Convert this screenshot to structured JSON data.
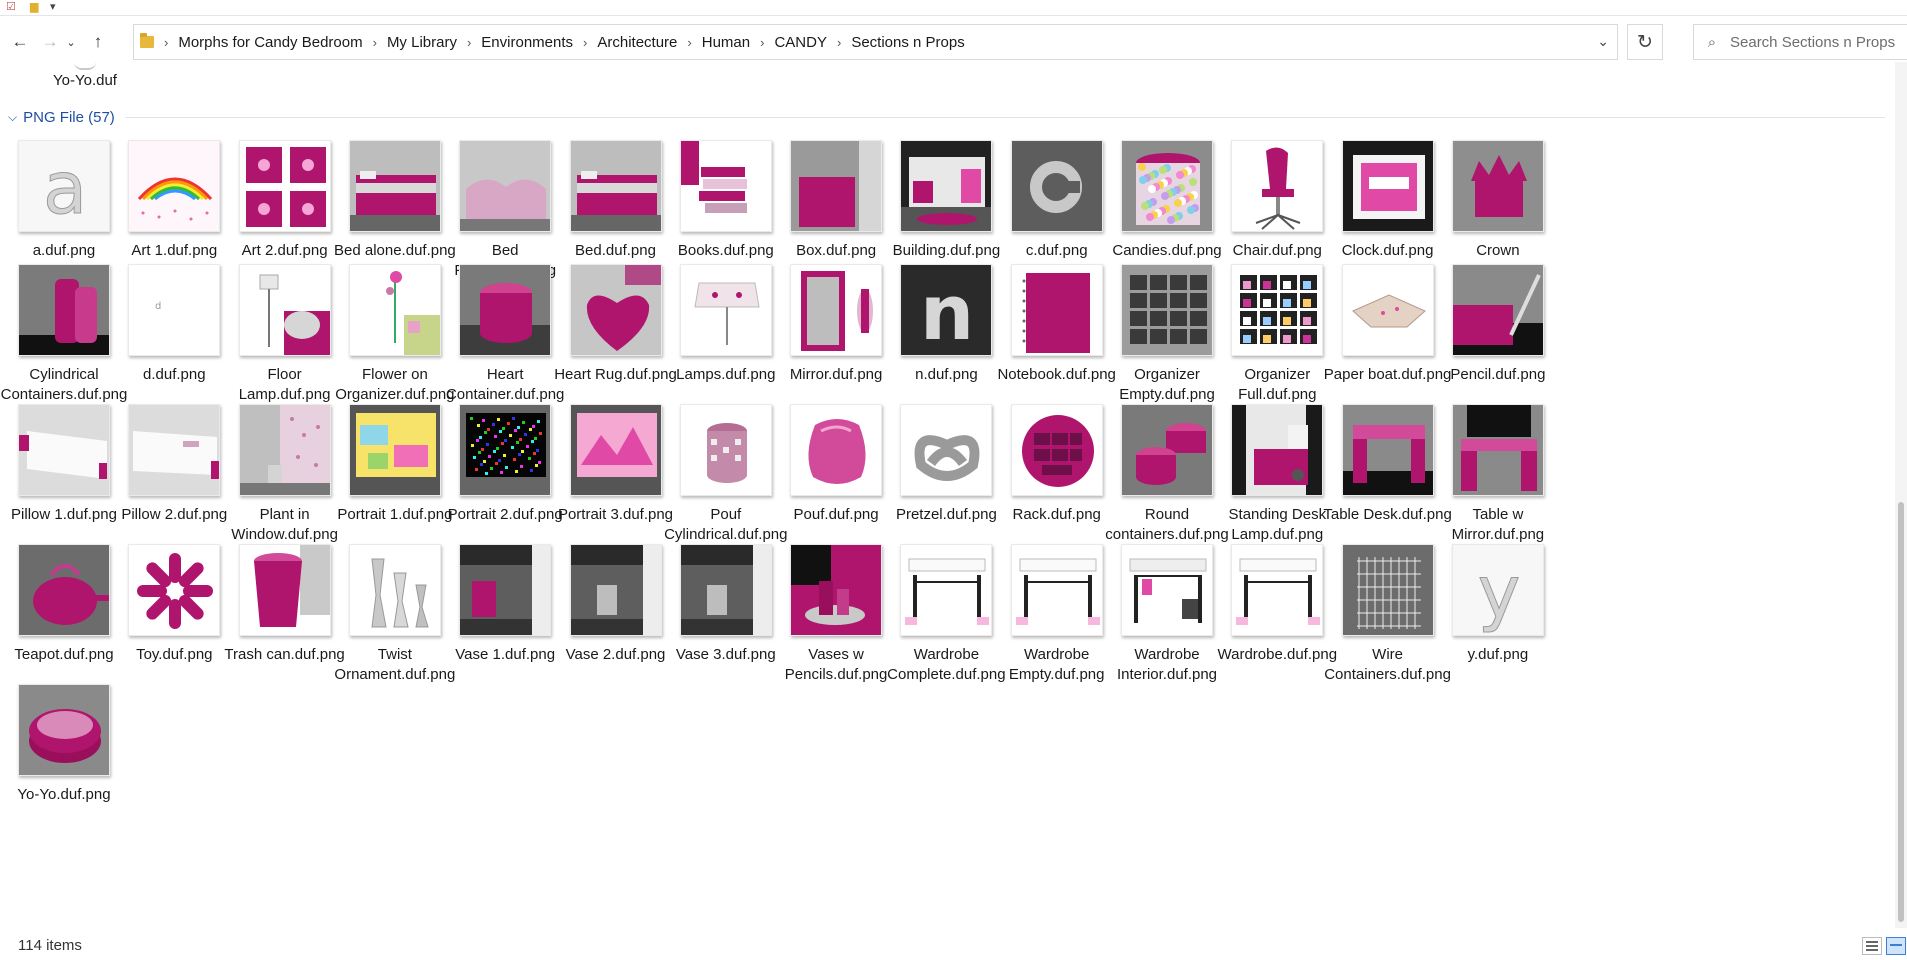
{
  "address": {
    "crumbs": [
      "Morphs for Candy Bedroom",
      "My Library",
      "Environments",
      "Architecture",
      "Human",
      "CANDY",
      "Sections n Props"
    ]
  },
  "search": {
    "placeholder": "Search Sections n Props"
  },
  "previous_item": {
    "label": "Yo-Yo.duf"
  },
  "group": {
    "header": "PNG File (57)"
  },
  "files": [
    {
      "label": "a.duf.png",
      "thumb": "letter",
      "glyph": "a"
    },
    {
      "label": "Art 1.duf.png",
      "thumb": "rainbow"
    },
    {
      "label": "Art 2.duf.png",
      "thumb": "art2"
    },
    {
      "label": "Bed alone.duf.png",
      "thumb": "bed"
    },
    {
      "label": "Bed Protect.duf.png",
      "thumb": "bedprotect"
    },
    {
      "label": "Bed.duf.png",
      "thumb": "bed"
    },
    {
      "label": "Books.duf.png",
      "thumb": "books"
    },
    {
      "label": "Box.duf.png",
      "thumb": "box"
    },
    {
      "label": "Building.duf.png",
      "thumb": "building"
    },
    {
      "label": "c.duf.png",
      "thumb": "cring"
    },
    {
      "label": "Candies.duf.png",
      "thumb": "candies"
    },
    {
      "label": "Chair.duf.png",
      "thumb": "chair"
    },
    {
      "label": "Clock.duf.png",
      "thumb": "clock"
    },
    {
      "label": "Crown Vase.duf.png",
      "thumb": "crown"
    },
    {
      "label": "Cylindrical Containers.duf.png",
      "thumb": "cylinders"
    },
    {
      "label": "d.duf.png",
      "thumb": "tinyd"
    },
    {
      "label": "Floor Lamp.duf.png",
      "thumb": "floorlamp"
    },
    {
      "label": "Flower on Organizer.duf.png",
      "thumb": "flower"
    },
    {
      "label": "Heart Container.duf.png",
      "thumb": "heartcontainer"
    },
    {
      "label": "Heart Rug.duf.png",
      "thumb": "heartrug"
    },
    {
      "label": "Lamps.duf.png",
      "thumb": "lampshade"
    },
    {
      "label": "Mirror.duf.png",
      "thumb": "mirror"
    },
    {
      "label": "n.duf.png",
      "thumb": "nletter"
    },
    {
      "label": "Notebook.duf.png",
      "thumb": "notebook"
    },
    {
      "label": "Organizer Empty.duf.png",
      "thumb": "orgempty"
    },
    {
      "label": "Organizer Full.duf.png",
      "thumb": "orgfull"
    },
    {
      "label": "Paper boat.duf.png",
      "thumb": "boat"
    },
    {
      "label": "Pencil.duf.png",
      "thumb": "pencil"
    },
    {
      "label": "Pillow 1.duf.png",
      "thumb": "pillow"
    },
    {
      "label": "Pillow 2.duf.png",
      "thumb": "pillow2"
    },
    {
      "label": "Plant in Window.duf.png",
      "thumb": "plant"
    },
    {
      "label": "Portrait 1.duf.png",
      "thumb": "portrait1"
    },
    {
      "label": "Portrait 2.duf.png",
      "thumb": "portrait2"
    },
    {
      "label": "Portrait 3.duf.png",
      "thumb": "portrait3"
    },
    {
      "label": "Pouf Cylindrical.duf.png",
      "thumb": "poufcyl"
    },
    {
      "label": "Pouf.duf.png",
      "thumb": "pouf"
    },
    {
      "label": "Pretzel.duf.png",
      "thumb": "pretzel"
    },
    {
      "label": "Rack.duf.png",
      "thumb": "rack"
    },
    {
      "label": "Round containers.duf.png",
      "thumb": "round"
    },
    {
      "label": "Standing Desk Lamp.duf.png",
      "thumb": "desklamp"
    },
    {
      "label": "Table Desk.duf.png",
      "thumb": "table"
    },
    {
      "label": "Table w Mirror.duf.png",
      "thumb": "tablemirror"
    },
    {
      "label": "Teapot.duf.png",
      "thumb": "teapot"
    },
    {
      "label": "Toy.duf.png",
      "thumb": "toy"
    },
    {
      "label": "Trash can.duf.png",
      "thumb": "trash"
    },
    {
      "label": "Twist Ornament.duf.png",
      "thumb": "twist"
    },
    {
      "label": "Vase 1.duf.png",
      "thumb": "vase1"
    },
    {
      "label": "Vase 2.duf.png",
      "thumb": "vase2"
    },
    {
      "label": "Vase 3.duf.png",
      "thumb": "vase2"
    },
    {
      "label": "Vases w Pencils.duf.png",
      "thumb": "vasespencils"
    },
    {
      "label": "Wardrobe Complete.duf.png",
      "thumb": "wardrobe"
    },
    {
      "label": "Wardrobe Empty.duf.png",
      "thumb": "wardrobe"
    },
    {
      "label": "Wardrobe Interior.duf.png",
      "thumb": "wardrobeint"
    },
    {
      "label": "Wardrobe.duf.png",
      "thumb": "wardrobe"
    },
    {
      "label": "Wire Containers.duf.png",
      "thumb": "wire"
    },
    {
      "label": "y.duf.png",
      "thumb": "letter",
      "glyph": "y"
    },
    {
      "label": "Yo-Yo.duf.png",
      "thumb": "yoyo"
    }
  ],
  "status": {
    "count": "114 items"
  },
  "colors": {
    "accent": "#1e4fa5",
    "magenta": "#b0156e",
    "pink": "#e04aa6"
  }
}
